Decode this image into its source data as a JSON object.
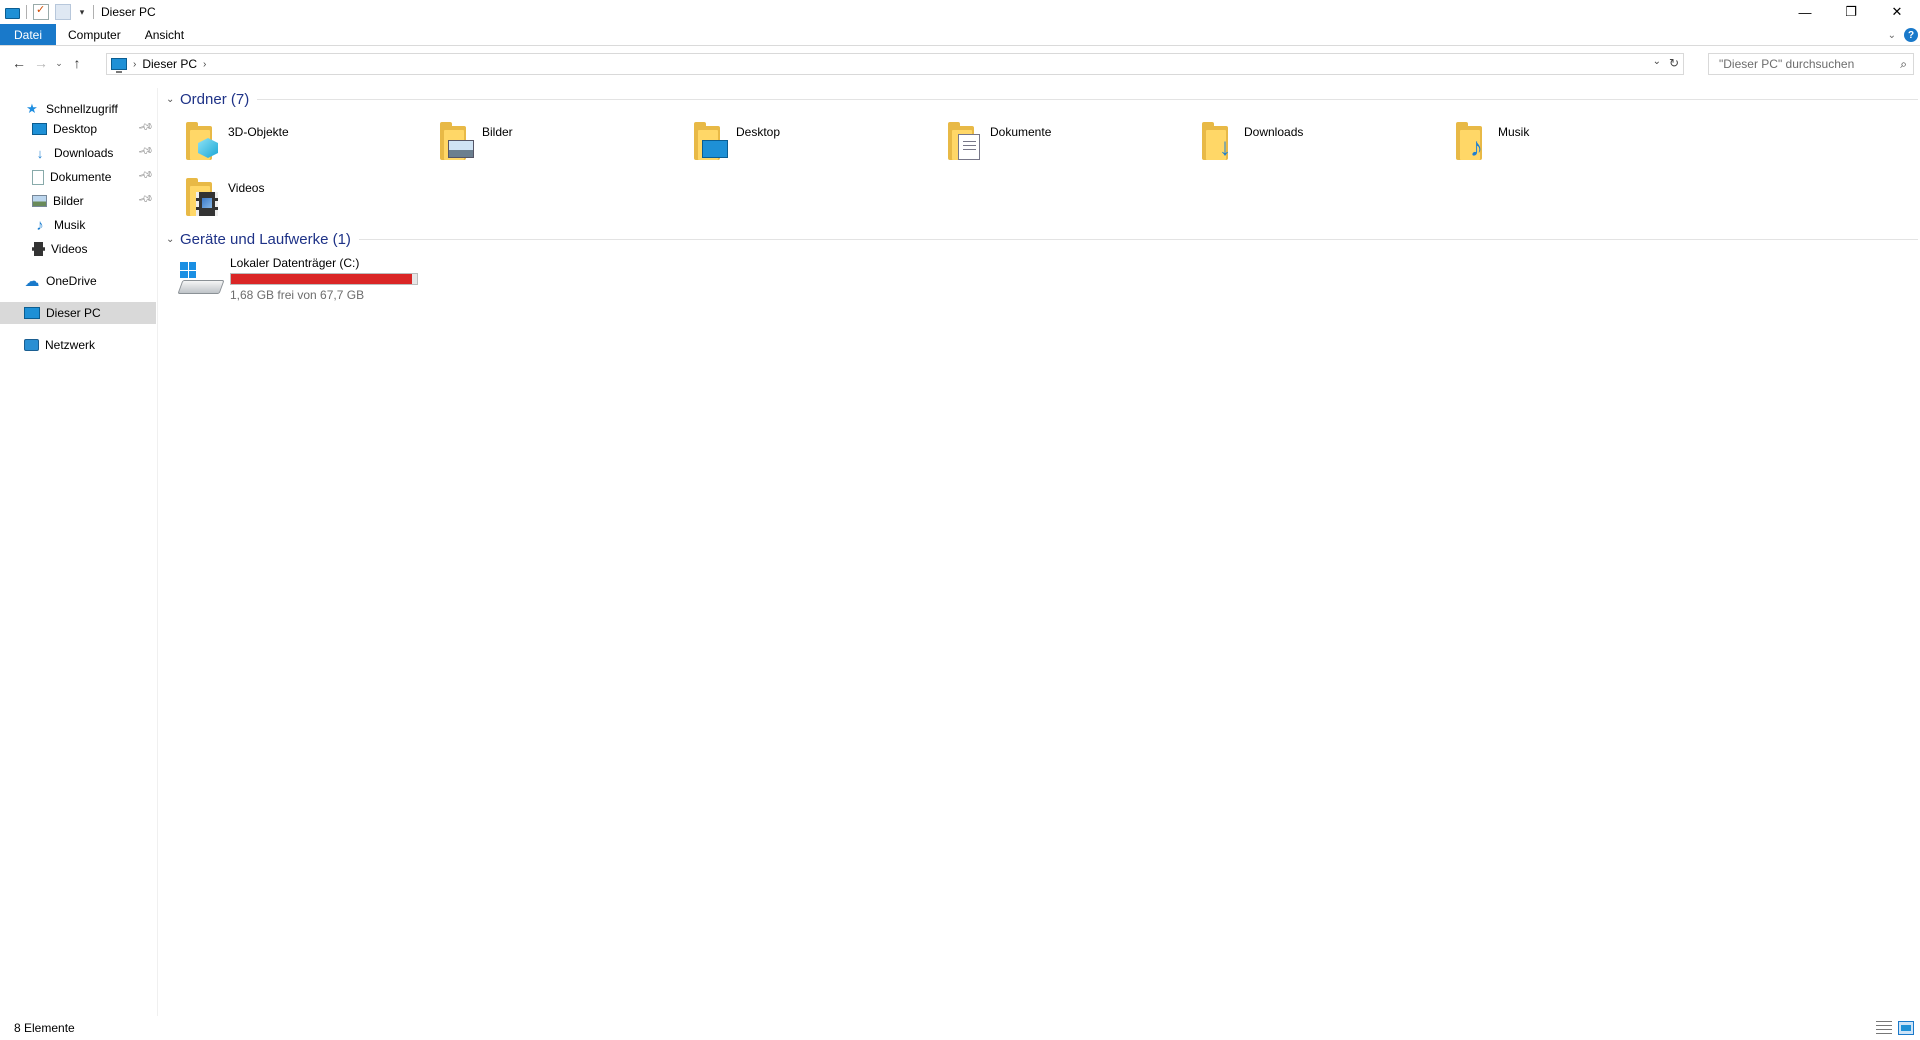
{
  "window": {
    "title": "Dieser PC",
    "controls": {
      "minimize": "—",
      "restore": "❐",
      "close": "✕"
    }
  },
  "ribbon": {
    "tabs": [
      "Datei",
      "Computer",
      "Ansicht"
    ],
    "expand_icon": "chevron-down-icon",
    "help_label": "?"
  },
  "address": {
    "back": "←",
    "forward": "→",
    "recent": "⌄",
    "up": "↑",
    "crumbs": [
      "Dieser PC"
    ],
    "crumb_sep": "›",
    "dropdown": "⌄",
    "refresh": "↻"
  },
  "search": {
    "placeholder": "\"Dieser PC\" durchsuchen",
    "icon": "⌕"
  },
  "nav": {
    "quick_access": "Schnellzugriff",
    "items": [
      {
        "label": "Desktop",
        "pinned": true
      },
      {
        "label": "Downloads",
        "pinned": true
      },
      {
        "label": "Dokumente",
        "pinned": true
      },
      {
        "label": "Bilder",
        "pinned": true
      },
      {
        "label": "Musik",
        "pinned": false
      },
      {
        "label": "Videos",
        "pinned": false
      }
    ],
    "onedrive": "OneDrive",
    "this_pc": "Dieser PC",
    "network": "Netzwerk"
  },
  "content": {
    "folders_header": "Ordner (7)",
    "folders": [
      "3D-Objekte",
      "Bilder",
      "Desktop",
      "Dokumente",
      "Downloads",
      "Musik",
      "Videos"
    ],
    "devices_header": "Geräte und Laufwerke (1)",
    "drive": {
      "name": "Lokaler Datenträger (C:)",
      "free_text": "1,68 GB frei von 67,7 GB",
      "used_fraction": 0.975,
      "bar_color": "#da2626"
    }
  },
  "status": {
    "count": "8 Elemente"
  },
  "colors": {
    "accent": "#1979ca",
    "group_header": "#1e3287",
    "selection": "#d9d9d9"
  }
}
